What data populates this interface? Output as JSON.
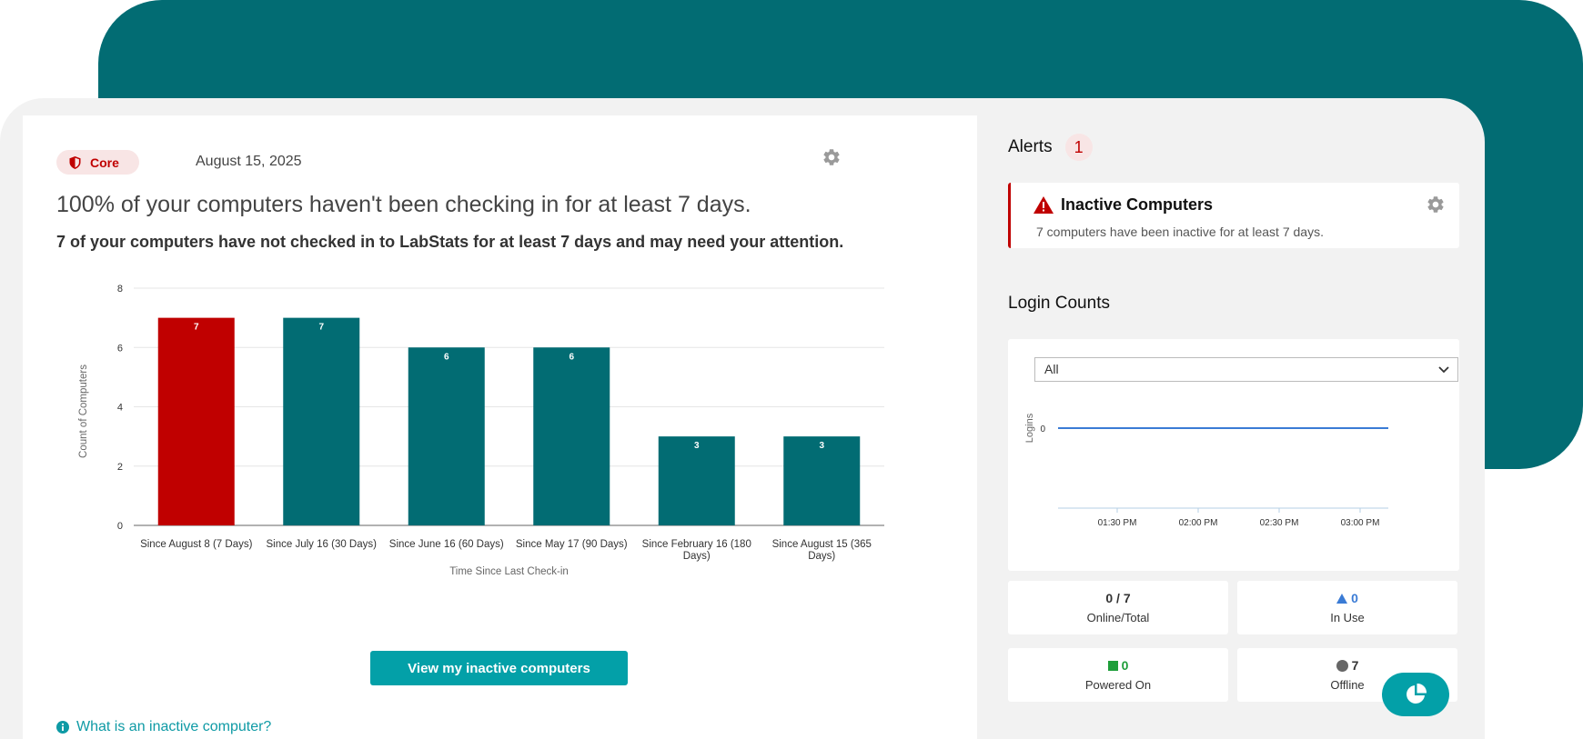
{
  "colors": {
    "teal": "#026c73",
    "red": "#c00000",
    "accent": "#03a0a8"
  },
  "main": {
    "badge": {
      "label": "Core",
      "icon": "shield-icon"
    },
    "date": "August 15, 2025",
    "headline": "100% of your computers haven't been checking in for at least 7 days.",
    "subline": "7 of your computers have not checked in to LabStats for at least 7 days and may need your attention.",
    "cta_label": "View my inactive computers",
    "help_label": "What is an inactive computer?"
  },
  "chart_data": {
    "type": "bar",
    "categories": [
      "Since August 8 (7 Days)",
      "Since July 16 (30 Days)",
      "Since June 16 (60 Days)",
      "Since May 17 (90 Days)",
      "Since February 16 (180 Days)",
      "Since August 15 (365 Days)"
    ],
    "category_lines": [
      [
        "Since August 8 (7 Days)"
      ],
      [
        "Since July 16 (30 Days)"
      ],
      [
        "Since June 16 (60 Days)"
      ],
      [
        "Since May 17 (90 Days)"
      ],
      [
        "Since February 16 (180",
        "Days)"
      ],
      [
        "Since August 15 (365",
        "Days)"
      ]
    ],
    "values": [
      7,
      7,
      6,
      6,
      3,
      3
    ],
    "bar_colors": [
      "#c00000",
      "#026c73",
      "#026c73",
      "#026c73",
      "#026c73",
      "#026c73"
    ],
    "xlabel": "Time Since Last Check-in",
    "ylabel": "Count of Computers",
    "ylim": [
      0,
      8
    ],
    "yticks": [
      0,
      2,
      4,
      6,
      8
    ],
    "grid": true
  },
  "sidebar": {
    "alerts_title": "Alerts",
    "alerts_count": "1",
    "alert": {
      "title": "Inactive Computers",
      "description": "7 computers have been inactive for at least 7 days."
    },
    "login_title": "Login Counts",
    "select_value": "All",
    "login_chart": {
      "type": "line",
      "ylabel": "Logins",
      "yticks": [
        "0"
      ],
      "x_ticks": [
        "01:30 PM",
        "02:00 PM",
        "02:30 PM",
        "03:00 PM"
      ],
      "value": 0
    },
    "stats": {
      "online": {
        "value": "0 / 7",
        "label": "Online/Total"
      },
      "in_use": {
        "value": "0",
        "label": "In Use",
        "color": "#3a7bd5"
      },
      "powered_on": {
        "value": "0",
        "label": "Powered On",
        "color": "#1e9e3a"
      },
      "offline": {
        "value": "7",
        "label": "Offline",
        "color": "#666666"
      }
    }
  }
}
